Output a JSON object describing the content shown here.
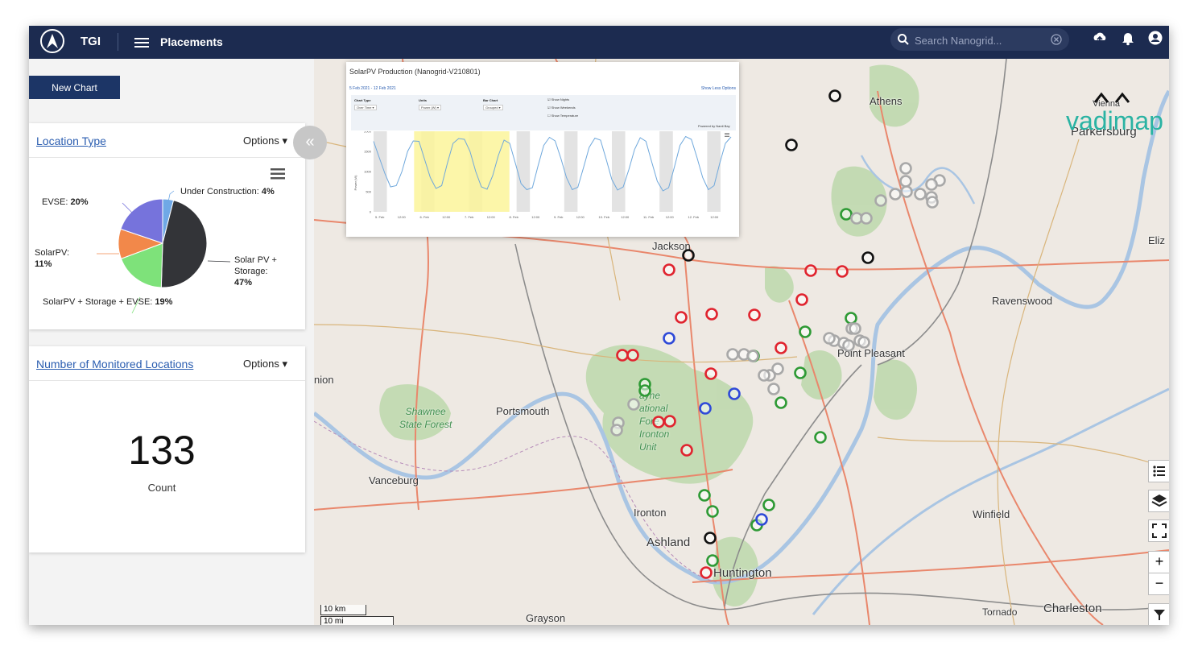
{
  "app": {
    "brand": "TGI",
    "nav_title": "Placements"
  },
  "search": {
    "placeholder": "Search Nanogrid..."
  },
  "toolbar": {
    "icons": [
      "menu-icon",
      "search-icon",
      "clear-icon",
      "upload-icon",
      "bell-icon",
      "user-icon"
    ]
  },
  "sidebar": {
    "new_chart_label": "New Chart",
    "collapse_glyph": "«",
    "location_type": {
      "title": "Location Type",
      "options_label": "Options ▾",
      "chart_data": {
        "type": "pie",
        "slices": [
          {
            "label": "Under Construction:",
            "percent_label": "4%",
            "value": 4,
            "color": "#6fa8e6"
          },
          {
            "label": "Solar PV + Storage:",
            "percent_label": "47%",
            "value": 47,
            "color": "#333438"
          },
          {
            "label": "SolarPV + Storage + EVSE:",
            "percent_label": "19%",
            "value": 19,
            "color": "#7ee27a"
          },
          {
            "label": "SolarPV:",
            "percent_label": "11%",
            "value": 11,
            "color": "#f2884a"
          },
          {
            "label": "EVSE:",
            "percent_label": "20%",
            "value": 20,
            "color": "#7673dc"
          }
        ]
      },
      "labels": {
        "under_construction": "Under Construction:",
        "under_construction_pct": "4%",
        "evse": "EVSE:",
        "evse_pct": "20%",
        "solarpv": "SolarPV:",
        "solarpv_pct": "11%",
        "solarpv_storage_line1": "Solar PV +",
        "solarpv_storage_line2": "Storage:",
        "solarpv_storage_pct": "47%",
        "sp_storage_evse": "SolarPV + Storage + EVSE:",
        "sp_storage_evse_pct": "19%"
      }
    },
    "monitored": {
      "title": "Number of Monitored Locations",
      "options_label": "Options ▾",
      "count": "133",
      "count_label": "Count"
    }
  },
  "popup": {
    "title": "SolarPV Production (Nanogrid-V210801)",
    "date_range": "5 Feb 2021 - 12 Feb 2021",
    "link": "Show Less Options",
    "controls": {
      "chart_type_label": "Chart Type",
      "chart_type_value": "Over Time ▾",
      "units_label": "Units",
      "units_value": "Power (W) ▾",
      "bar_chart_label": "Bar Chart",
      "bar_chart_value": "Grouped ▾",
      "show_nights": "Show Nights",
      "show_weekends": "Show Weekends",
      "show_temperature": "Show Temperature"
    },
    "powered_by": "Powered by Nanti Bay",
    "chart_data": {
      "type": "line",
      "ylabel": "Power (W)",
      "yticks": [
        "2000",
        "1500",
        "1000",
        "500",
        "0"
      ],
      "ylim": [
        0,
        2000
      ],
      "xticks": [
        "5. Feb",
        "12:00",
        "6. Feb",
        "12:00",
        "7. Feb",
        "12:00",
        "8. Feb",
        "12:00",
        "9. Feb",
        "12:00",
        "10. Feb",
        "12:00",
        "11. Feb",
        "12:00",
        "12. Feb",
        "12:00"
      ],
      "series": [
        {
          "color": "#6fa8dc",
          "values": [
            1750,
            1350,
            950,
            620,
            650,
            1000,
            1500,
            1760,
            1750,
            1300,
            850,
            580,
            650,
            1200,
            1700,
            1820,
            1800,
            1500,
            1000,
            620,
            560,
            900,
            1400,
            1780,
            1700,
            1200,
            700,
            550,
            600,
            1150,
            1650,
            1850,
            1760,
            1330,
            850,
            550,
            610,
            1100,
            1600,
            1830,
            1780,
            1300,
            800,
            540,
            620,
            1050,
            1550,
            1840,
            1750,
            1250,
            760,
            520,
            600,
            1100,
            1650,
            1870,
            1800,
            1350,
            850,
            550,
            650,
            1200,
            1700,
            1860
          ]
        }
      ],
      "night_bands": 8,
      "weekend_highlight": [
        "6. Feb",
        "8. Feb"
      ]
    }
  },
  "map": {
    "labels": {
      "athens": "Athens",
      "vienna": "Vienna",
      "parkersburg": "Parkersburg",
      "eliz": "Eliz",
      "jackson": "Jackson",
      "ravenswood": "Ravenswood",
      "point_pleasant": "Point Pleasant",
      "nion": "nion",
      "portsmouth": "Portsmouth",
      "vanceburg": "Vanceburg",
      "ironton": "Ironton",
      "ashland": "Ashland",
      "huntington": "Huntington",
      "winfield": "Winfield",
      "tornado": "Tornado",
      "charleston": "Charleston",
      "grayson": "Grayson",
      "shawnee": "Shawnee State Forest",
      "wayne": "Wayne National Forest Ironton Unit"
    },
    "forest_labels": {
      "shawnee_1": "Shawnee",
      "shawnee_2": "State Forest",
      "wayne_1": "ayne",
      "wayne_2": "ational",
      "wayne_3": "Fore",
      "wayne_4": "Ironton",
      "wayne_5": "Unit"
    },
    "scale": {
      "km": "10 km",
      "mi": "10 mi"
    },
    "brand_text": "vadimap",
    "colors": {
      "red": "#e0242f",
      "green": "#2e9a35",
      "blue": "#2f4ad8",
      "gray": "#a8a8a8",
      "black": "#111111"
    },
    "controls": [
      "list-icon",
      "layers-icon",
      "fullscreen-icon",
      "zoom-in-icon",
      "zoom-out-icon",
      "filter-icon"
    ],
    "zoom_in": "+",
    "zoom_out": "−"
  }
}
